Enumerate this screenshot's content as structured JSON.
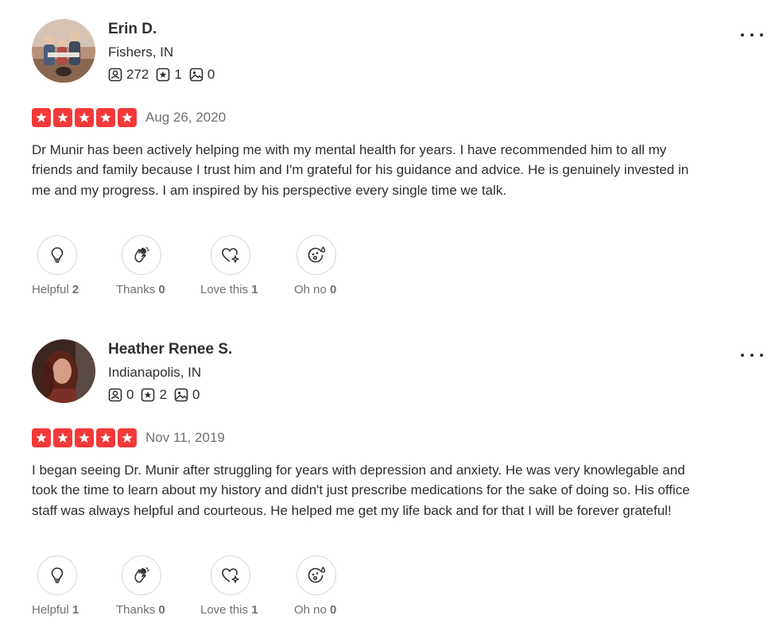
{
  "reviews": [
    {
      "name": "Erin D.",
      "location": "Fishers, IN",
      "stats": {
        "friends": "272",
        "reviews": "1",
        "photos": "0"
      },
      "rating": 5,
      "date": "Aug 26, 2020",
      "comment": "Dr Munir has been actively helping me with my mental health for years. I have recommended him to all my friends and family because I trust him and I'm grateful for his guidance and advice. He is genuinely invested in me and my progress. I am inspired by his perspective every single time we talk.",
      "reactions": {
        "helpful_label": "Helpful",
        "helpful_count": "2",
        "thanks_label": "Thanks",
        "thanks_count": "0",
        "love_label": "Love this",
        "love_count": "1",
        "ohno_label": "Oh no",
        "ohno_count": "0"
      }
    },
    {
      "name": "Heather Renee S.",
      "location": "Indianapolis, IN",
      "stats": {
        "friends": "0",
        "reviews": "2",
        "photos": "0"
      },
      "rating": 5,
      "date": "Nov 11, 2019",
      "comment": "I began seeing Dr. Munir after struggling for years with depression and anxiety. He was very knowlegable and took the time to learn about my history and didn't just prescribe medications for the sake of doing so. His office staff was always helpful and courteous. He helped me get my life back and for that I will be forever grateful!",
      "reactions": {
        "helpful_label": "Helpful",
        "helpful_count": "1",
        "thanks_label": "Thanks",
        "thanks_count": "0",
        "love_label": "Love this",
        "love_count": "1",
        "ohno_label": "Oh no",
        "ohno_count": "0"
      }
    }
  ],
  "icons": {
    "friends": "friends-icon",
    "reviews": "review-star-icon",
    "photos": "photo-icon",
    "helpful": "lightbulb-icon",
    "thanks": "clapping-hands-icon",
    "love": "heart-sparkle-icon",
    "ohno": "sad-face-icon",
    "more": "more-options-icon"
  },
  "colors": {
    "star": "#f43939",
    "text": "#2d2e2f",
    "muted": "#6e7072",
    "border": "#d6d6d6"
  }
}
